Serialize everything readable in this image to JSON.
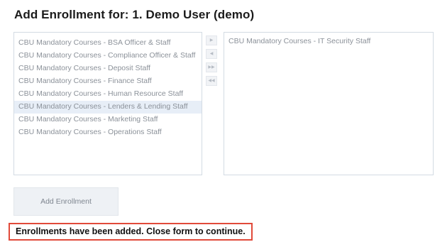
{
  "page": {
    "title": "Add Enrollment for: 1. Demo User (demo)"
  },
  "available_courses": [
    {
      "label": "CBU Mandatory Courses - BSA Officer & Staff",
      "selected": false
    },
    {
      "label": "CBU Mandatory Courses - Compliance Officer & Staff",
      "selected": false
    },
    {
      "label": "CBU Mandatory Courses - Deposit Staff",
      "selected": false
    },
    {
      "label": "CBU Mandatory Courses - Finance Staff",
      "selected": false
    },
    {
      "label": "CBU Mandatory Courses - Human Resource Staff",
      "selected": false
    },
    {
      "label": "CBU Mandatory Courses - Lenders & Lending Staff",
      "selected": true
    },
    {
      "label": "CBU Mandatory Courses - Marketing Staff",
      "selected": false
    },
    {
      "label": "CBU Mandatory Courses - Operations Staff",
      "selected": false
    }
  ],
  "selected_courses": [
    {
      "label": "CBU Mandatory Courses - IT Security Staff"
    }
  ],
  "transfer_buttons": {
    "move_right": "▶",
    "move_left": "◀",
    "move_all_right": "▶▶",
    "move_all_left": "◀◀"
  },
  "actions": {
    "add_enrollment": "Add Enrollment"
  },
  "status": {
    "message": "Enrollments have been added. Close form to continue.",
    "border_color": "#e14a3a"
  }
}
